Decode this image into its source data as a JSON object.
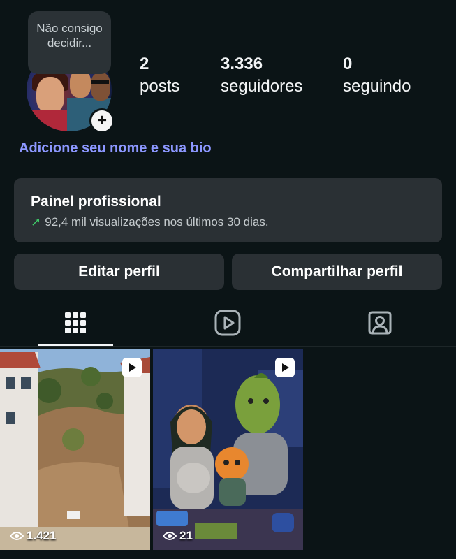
{
  "profile": {
    "note_bubble": "Não consigo decidir...",
    "bio_prompt": "Adicione seu nome e sua bio"
  },
  "stats": [
    {
      "value": "2",
      "label": "posts"
    },
    {
      "value": "3.336",
      "label": "seguidores"
    },
    {
      "value": "0",
      "label": "seguindo"
    }
  ],
  "dashboard": {
    "title": "Painel profissional",
    "subtitle": "92,4 mil visualizações nos últimos 30 dias."
  },
  "actions": {
    "edit_label": "Editar perfil",
    "share_label": "Compartilhar perfil"
  },
  "tabs": [
    {
      "icon": "grid-icon",
      "active": true
    },
    {
      "icon": "reels-icon",
      "active": false
    },
    {
      "icon": "tagged-icon",
      "active": false
    }
  ],
  "posts": [
    {
      "type": "reel",
      "views": "1.421",
      "icon": "eye-icon"
    },
    {
      "type": "reel",
      "views": "21",
      "icon": "eye-icon"
    }
  ],
  "colors": {
    "background": "#0b1416",
    "card": "#2a3034",
    "bio_link": "#8c97ff",
    "trend_up": "#3fcf6a"
  }
}
